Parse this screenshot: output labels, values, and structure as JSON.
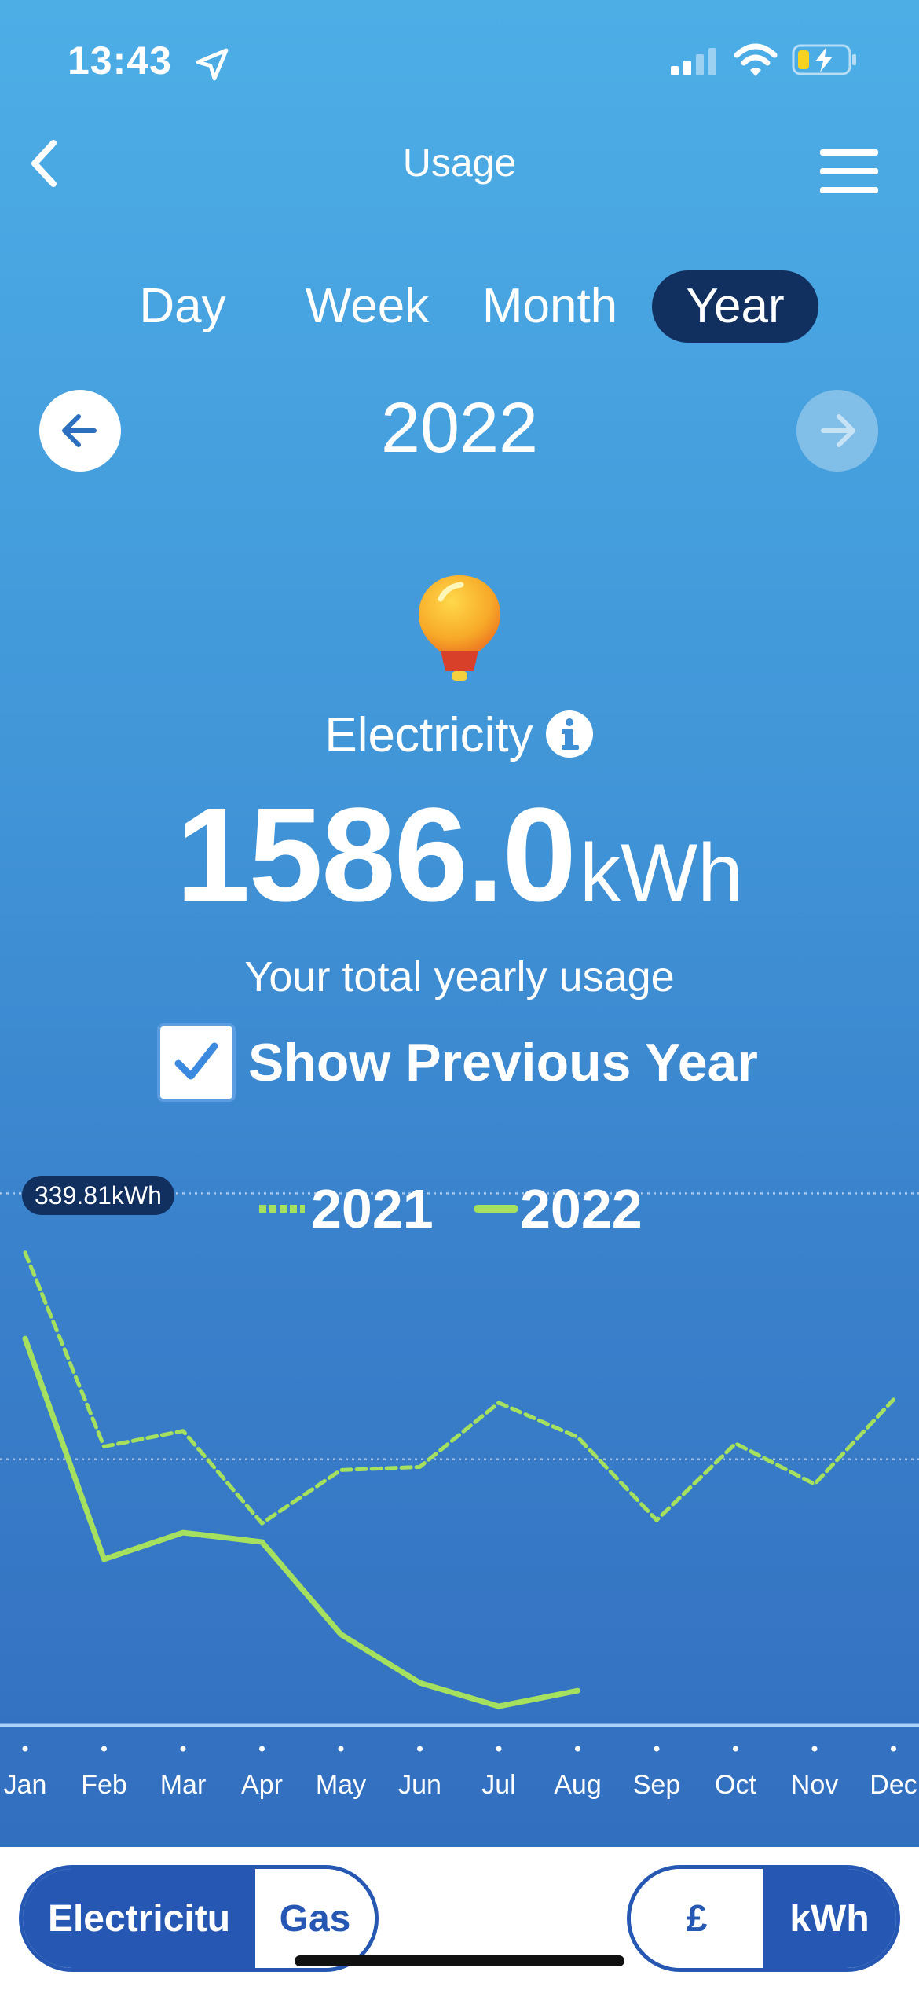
{
  "status": {
    "time": "13:43"
  },
  "nav": {
    "title": "Usage"
  },
  "tabs": [
    {
      "label": "Day",
      "active": false
    },
    {
      "label": "Week",
      "active": false
    },
    {
      "label": "Month",
      "active": false
    },
    {
      "label": "Year",
      "active": true
    }
  ],
  "period": {
    "year": "2022"
  },
  "summary": {
    "energy_type": "Electricity",
    "total_value": "1586.0",
    "total_unit": "kWh",
    "caption": "Your total yearly usage",
    "show_previous_year_label": "Show Previous Year",
    "show_previous_year_checked": true
  },
  "chart_data": {
    "type": "line",
    "categories": [
      "Jan",
      "Feb",
      "Mar",
      "Apr",
      "May",
      "Jun",
      "Jul",
      "Aug",
      "Sep",
      "Oct",
      "Nov",
      "Dec"
    ],
    "series": [
      {
        "name": "2021",
        "style": "dashed",
        "color": "#a6e05f",
        "values": [
          302,
          178,
          188,
          129,
          163,
          165,
          206,
          184,
          131,
          180,
          154,
          208
        ]
      },
      {
        "name": "2022",
        "style": "solid",
        "color": "#a6e05f",
        "values": [
          247,
          106,
          123,
          117,
          58,
          27,
          12,
          22
        ]
      }
    ],
    "tooltip": "339.81kWh",
    "ylim": [
      0,
      340
    ],
    "gridlines": [
      339.81,
      169.9
    ],
    "legend_position": "top"
  },
  "bottom": {
    "fuel": {
      "electricity": "Electricitu",
      "gas": "Gas",
      "selected": "electricity"
    },
    "unit": {
      "pound": "£",
      "kwh": "kWh",
      "selected": "kwh"
    }
  },
  "colors": {
    "accent_dark": "#12305f",
    "line": "#a6e05f",
    "button_blue": "#2658b3"
  }
}
